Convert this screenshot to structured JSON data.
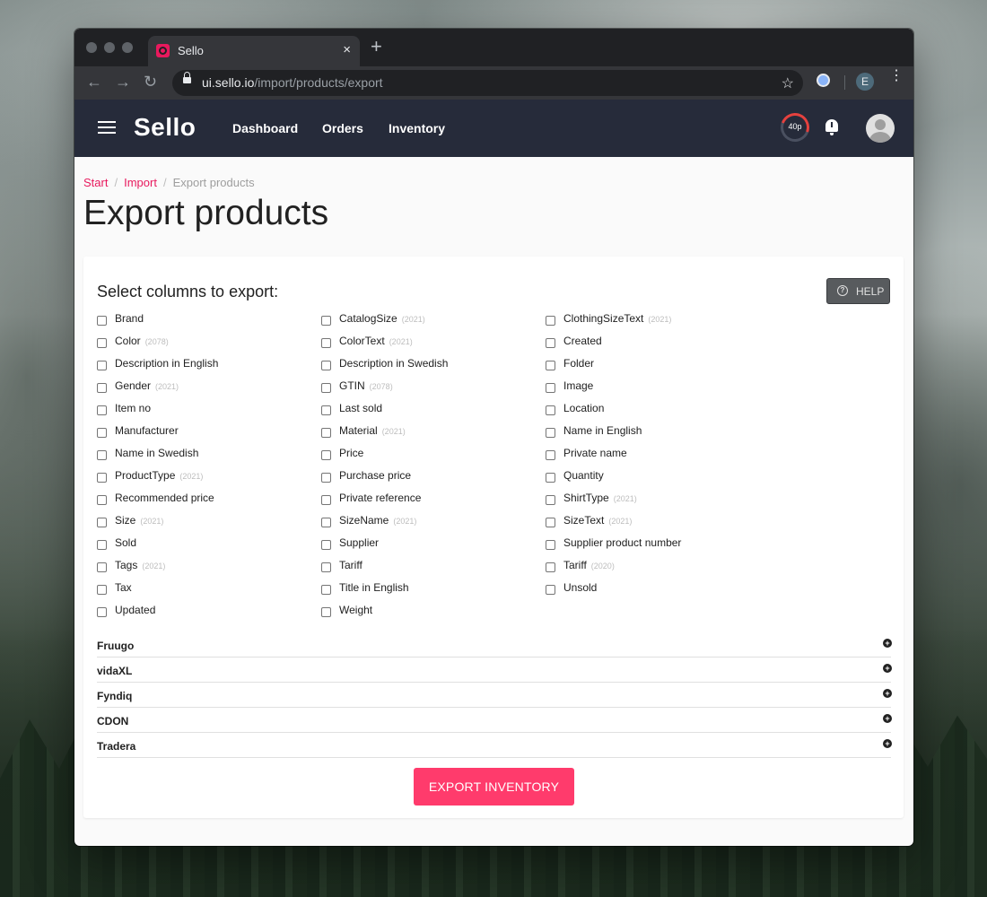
{
  "browser": {
    "tab_title": "Sello",
    "tab_close": "×",
    "new_tab": "+",
    "url_host": "ui.sello.io",
    "url_path": "/import/products/export",
    "profile_initial": "E"
  },
  "app": {
    "logo": "Sello",
    "nav": [
      "Dashboard",
      "Orders",
      "Inventory"
    ],
    "credits": "40p"
  },
  "breadcrumb": {
    "items": [
      "Start",
      "Import"
    ],
    "current": "Export products"
  },
  "page": {
    "title": "Export products",
    "section_title": "Select columns to export:",
    "help_label": "HELP",
    "export_button": "EXPORT INVENTORY"
  },
  "columns": [
    [
      {
        "label": "Brand",
        "count": ""
      },
      {
        "label": "Color",
        "count": "(2078)"
      },
      {
        "label": "Description in English",
        "count": ""
      },
      {
        "label": "Gender",
        "count": "(2021)"
      },
      {
        "label": "Item no",
        "count": ""
      },
      {
        "label": "Manufacturer",
        "count": ""
      },
      {
        "label": "Name in Swedish",
        "count": ""
      },
      {
        "label": "ProductType",
        "count": "(2021)"
      },
      {
        "label": "Recommended price",
        "count": ""
      },
      {
        "label": "Size",
        "count": "(2021)"
      },
      {
        "label": "Sold",
        "count": ""
      },
      {
        "label": "Tags",
        "count": "(2021)"
      },
      {
        "label": "Tax",
        "count": ""
      },
      {
        "label": "Updated",
        "count": ""
      }
    ],
    [
      {
        "label": "CatalogSize",
        "count": "(2021)"
      },
      {
        "label": "ColorText",
        "count": "(2021)"
      },
      {
        "label": "Description in Swedish",
        "count": ""
      },
      {
        "label": "GTIN",
        "count": "(2078)"
      },
      {
        "label": "Last sold",
        "count": ""
      },
      {
        "label": "Material",
        "count": "(2021)"
      },
      {
        "label": "Price",
        "count": ""
      },
      {
        "label": "Purchase price",
        "count": ""
      },
      {
        "label": "Private reference",
        "count": ""
      },
      {
        "label": "SizeName",
        "count": "(2021)"
      },
      {
        "label": "Supplier",
        "count": ""
      },
      {
        "label": "Tariff",
        "count": ""
      },
      {
        "label": "Title in English",
        "count": ""
      },
      {
        "label": "Weight",
        "count": ""
      }
    ],
    [
      {
        "label": "ClothingSizeText",
        "count": "(2021)"
      },
      {
        "label": "Created",
        "count": ""
      },
      {
        "label": "Folder",
        "count": ""
      },
      {
        "label": "Image",
        "count": ""
      },
      {
        "label": "Location",
        "count": ""
      },
      {
        "label": "Name in English",
        "count": ""
      },
      {
        "label": "Private name",
        "count": ""
      },
      {
        "label": "Quantity",
        "count": ""
      },
      {
        "label": "ShirtType",
        "count": "(2021)"
      },
      {
        "label": "SizeText",
        "count": "(2021)"
      },
      {
        "label": "Supplier product number",
        "count": ""
      },
      {
        "label": "Tariff",
        "count": "(2020)"
      },
      {
        "label": "Unsold",
        "count": ""
      }
    ]
  ],
  "sections": [
    "Fruugo",
    "vidaXL",
    "Fyndiq",
    "CDON",
    "Tradera"
  ],
  "colors": {
    "accent": "#e8195d",
    "button": "#ff3b6c",
    "header": "#262b3a"
  }
}
